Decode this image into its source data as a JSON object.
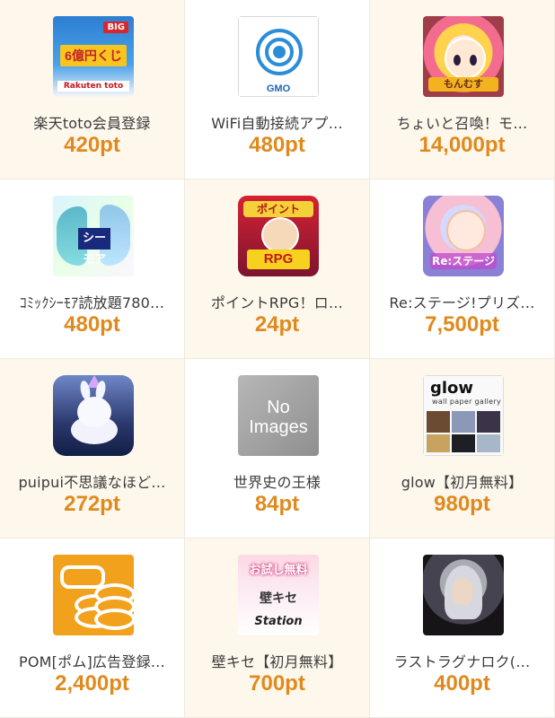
{
  "items": [
    {
      "name": "楽天toto会員登録",
      "points": "420pt"
    },
    {
      "name": "WiFi自動接続アプ…",
      "points": "480pt"
    },
    {
      "name": "ちょいと召喚！モ…",
      "points": "14,000pt"
    },
    {
      "name": "ｺﾐｯｸｼｰﾓｱ読放題780…",
      "points": "480pt"
    },
    {
      "name": "ポイントRPG！ロ…",
      "points": "24pt"
    },
    {
      "name": "Re:ステージ!プリズ…",
      "points": "7,500pt"
    },
    {
      "name": "puipui不思議なほど…",
      "points": "272pt"
    },
    {
      "name": "世界史の王様",
      "points": "84pt"
    },
    {
      "name": "glow【初月無料】",
      "points": "980pt"
    },
    {
      "name": "POM[ポム]広告登録…",
      "points": "2,400pt"
    },
    {
      "name": "壁キセ【初月無料】",
      "points": "700pt"
    },
    {
      "name": "ラストラグナロク(…",
      "points": "400pt"
    }
  ],
  "thumbs": {
    "toto_badge": "BIG",
    "toto_main": "6億円くじ",
    "toto_logo": "Rakuten toto",
    "wifi_logo": "GMO",
    "anime_logo": "もんむす",
    "comic_logo": "シーモア",
    "rpg_top": "ポイント",
    "rpg_bottom": "RPG",
    "stage_logo": "Re:ステージ",
    "noimg_line1": "No",
    "noimg_line2": "Images",
    "glow_title": "glow",
    "glow_sub": "wall paper gallery",
    "kabe_top": "お試し無料",
    "kabe_mid": "壁キセ",
    "kabe_foot": "Station"
  },
  "colors": {
    "points": "#e08a1e",
    "card_odd": "#fdf7ec",
    "card_even": "#ffffff"
  }
}
